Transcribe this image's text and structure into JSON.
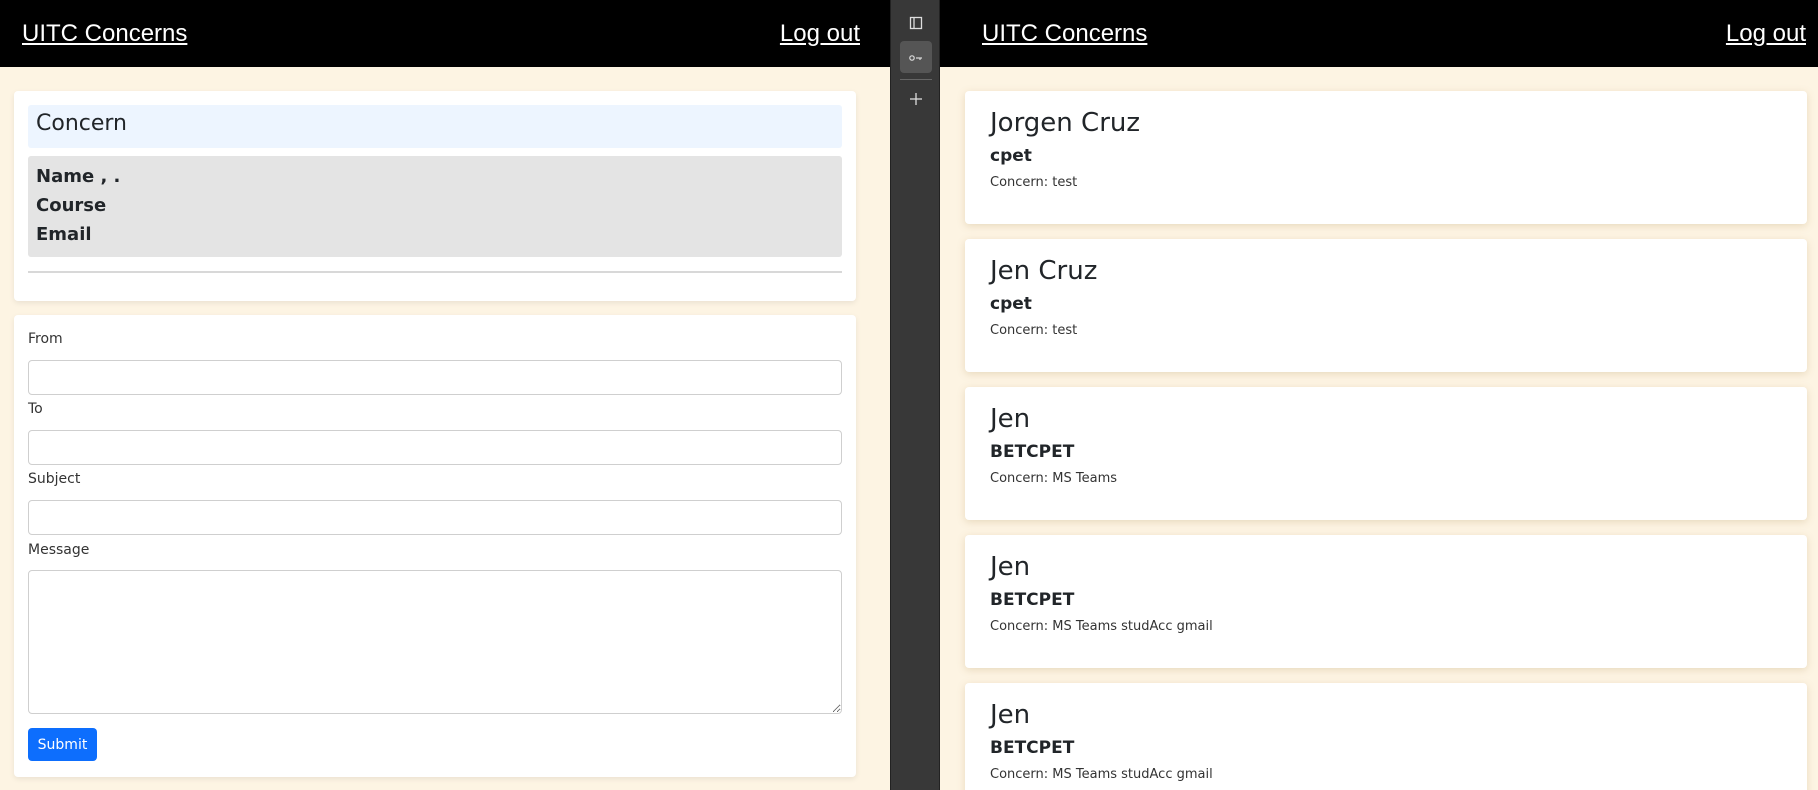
{
  "left_pane": {
    "nav": {
      "brand": "UITC Concerns",
      "logout": "Log out"
    },
    "concern_card": {
      "title": "Concern",
      "name_line": "Name , .",
      "course_line": "Course",
      "email_line": "Email"
    },
    "form": {
      "from_label": "From",
      "from_value": "",
      "to_label": "To",
      "to_value": "",
      "subject_label": "Subject",
      "subject_value": "",
      "message_label": "Message",
      "message_value": "",
      "submit_label": "Submit"
    }
  },
  "toolbar": {
    "icons": [
      "panel-icon",
      "keyboard-icon",
      "plus-icon"
    ]
  },
  "right_pane": {
    "nav": {
      "brand": "UITC Concerns",
      "logout": "Log out"
    },
    "entries": [
      {
        "name": "Jorgen Cruz",
        "course": "cpet",
        "concern": "Concern: test"
      },
      {
        "name": "Jen Cruz",
        "course": "cpet",
        "concern": "Concern: test"
      },
      {
        "name": "Jen",
        "course": "BETCPET",
        "concern": "Concern: MS Teams"
      },
      {
        "name": "Jen",
        "course": "BETCPET",
        "concern": "Concern: MS Teams studAcc gmail"
      },
      {
        "name": "Jen",
        "course": "BETCPET",
        "concern": "Concern: MS Teams studAcc gmail"
      }
    ]
  },
  "colors": {
    "page_bg": "#fdf4e3",
    "nav_bg": "#000000",
    "primary": "#0d6efd",
    "concern_header_bg": "#edf5ff",
    "concern_info_bg": "#e4e4e4",
    "toolbar_bg": "#383838"
  }
}
